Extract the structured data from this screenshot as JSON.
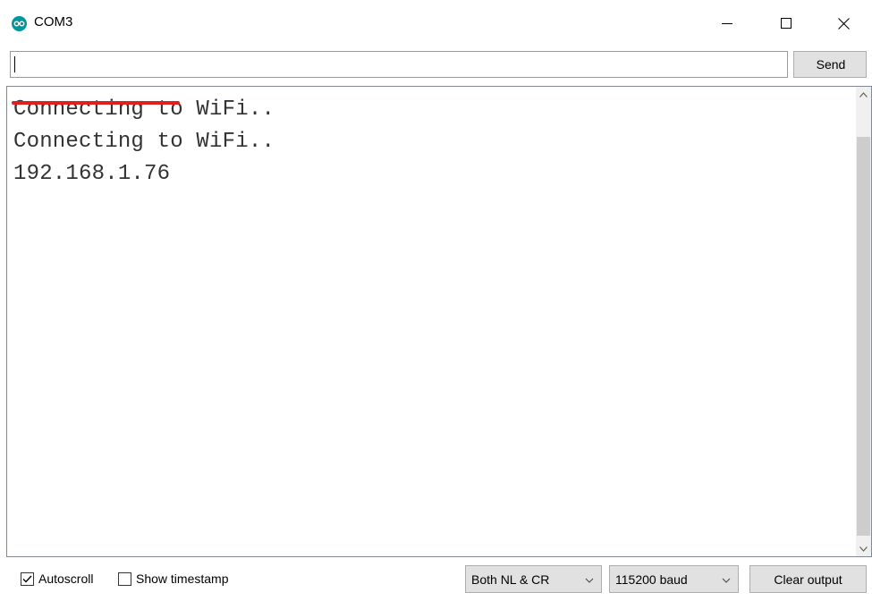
{
  "window": {
    "title": "COM3",
    "icon": "arduino-infinity-icon",
    "accent_color": "#00979c"
  },
  "send_bar": {
    "input_value": "",
    "send_label": "Send"
  },
  "output": {
    "lines": [
      "Connecting to WiFi..",
      "Connecting to WiFi..",
      "192.168.1.76"
    ],
    "highlight_color": "#e02020"
  },
  "footer": {
    "autoscroll_label": "Autoscroll",
    "autoscroll_checked": true,
    "timestamp_label": "Show timestamp",
    "timestamp_checked": false,
    "line_ending": "Both NL & CR",
    "baud_rate": "115200 baud",
    "clear_label": "Clear output"
  }
}
